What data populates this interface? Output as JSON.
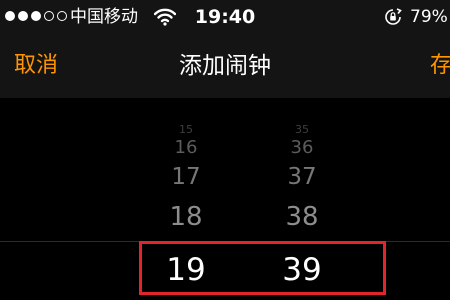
{
  "status_bar": {
    "carrier": "中国移动",
    "time": "19:40",
    "battery": "79%"
  },
  "nav": {
    "cancel_label": "取消",
    "title": "添加闹钟",
    "save_label": "存"
  },
  "picker": {
    "hours": [
      "15",
      "16",
      "17",
      "18",
      "19"
    ],
    "minutes": [
      "35",
      "36",
      "37",
      "38",
      "39"
    ],
    "selected_hour": "19",
    "selected_minute": "39"
  },
  "colors": {
    "accent": "#ff9500",
    "highlight": "#e0262b",
    "background": "#000000",
    "bar_background": "#141414"
  },
  "icons": {
    "signal": "signal-dots-icon",
    "wifi": "wifi-icon",
    "lock": "rotation-lock-icon"
  }
}
